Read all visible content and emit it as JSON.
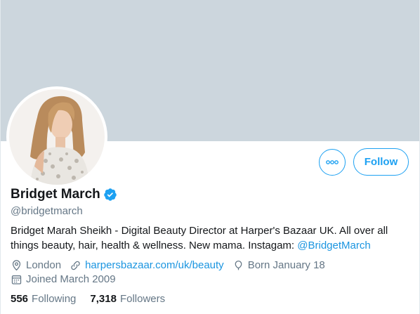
{
  "profile": {
    "display_name": "Bridget March",
    "handle": "@bridgetmarch",
    "verified": true,
    "bio_text": "Bridget Marah Sheikh - Digital Beauty Director at Harper's Bazaar UK. All over all things beauty, hair, health & wellness. New mama. Instagam: ",
    "bio_mention": "@BridgetMarch",
    "location": "London",
    "website": "harpersbazaar.com/uk/beauty",
    "birthday": "Born January 18",
    "joined": "Joined March 2009",
    "following_count": "556",
    "following_label": "Following",
    "followers_count": "7,318",
    "followers_label": "Followers"
  },
  "actions": {
    "more_icon": "more-dots-icon",
    "follow_label": "Follow"
  },
  "colors": {
    "accent": "#1da1f2",
    "link": "#1b95e0",
    "banner": "#ccd6dd",
    "muted": "#657786"
  }
}
